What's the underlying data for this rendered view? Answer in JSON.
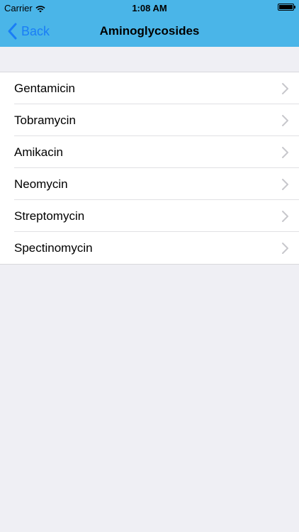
{
  "status_bar": {
    "carrier": "Carrier",
    "time": "1:08 AM"
  },
  "nav": {
    "back_label": "Back",
    "title": "Aminoglycosides"
  },
  "list": {
    "items": [
      {
        "label": "Gentamicin"
      },
      {
        "label": "Tobramycin"
      },
      {
        "label": "Amikacin"
      },
      {
        "label": "Neomycin"
      },
      {
        "label": "Streptomycin"
      },
      {
        "label": "Spectinomycin"
      }
    ]
  },
  "colors": {
    "header_background": "#4ab5e8",
    "accent": "#1a7ef6",
    "page_background": "#efeff4"
  }
}
